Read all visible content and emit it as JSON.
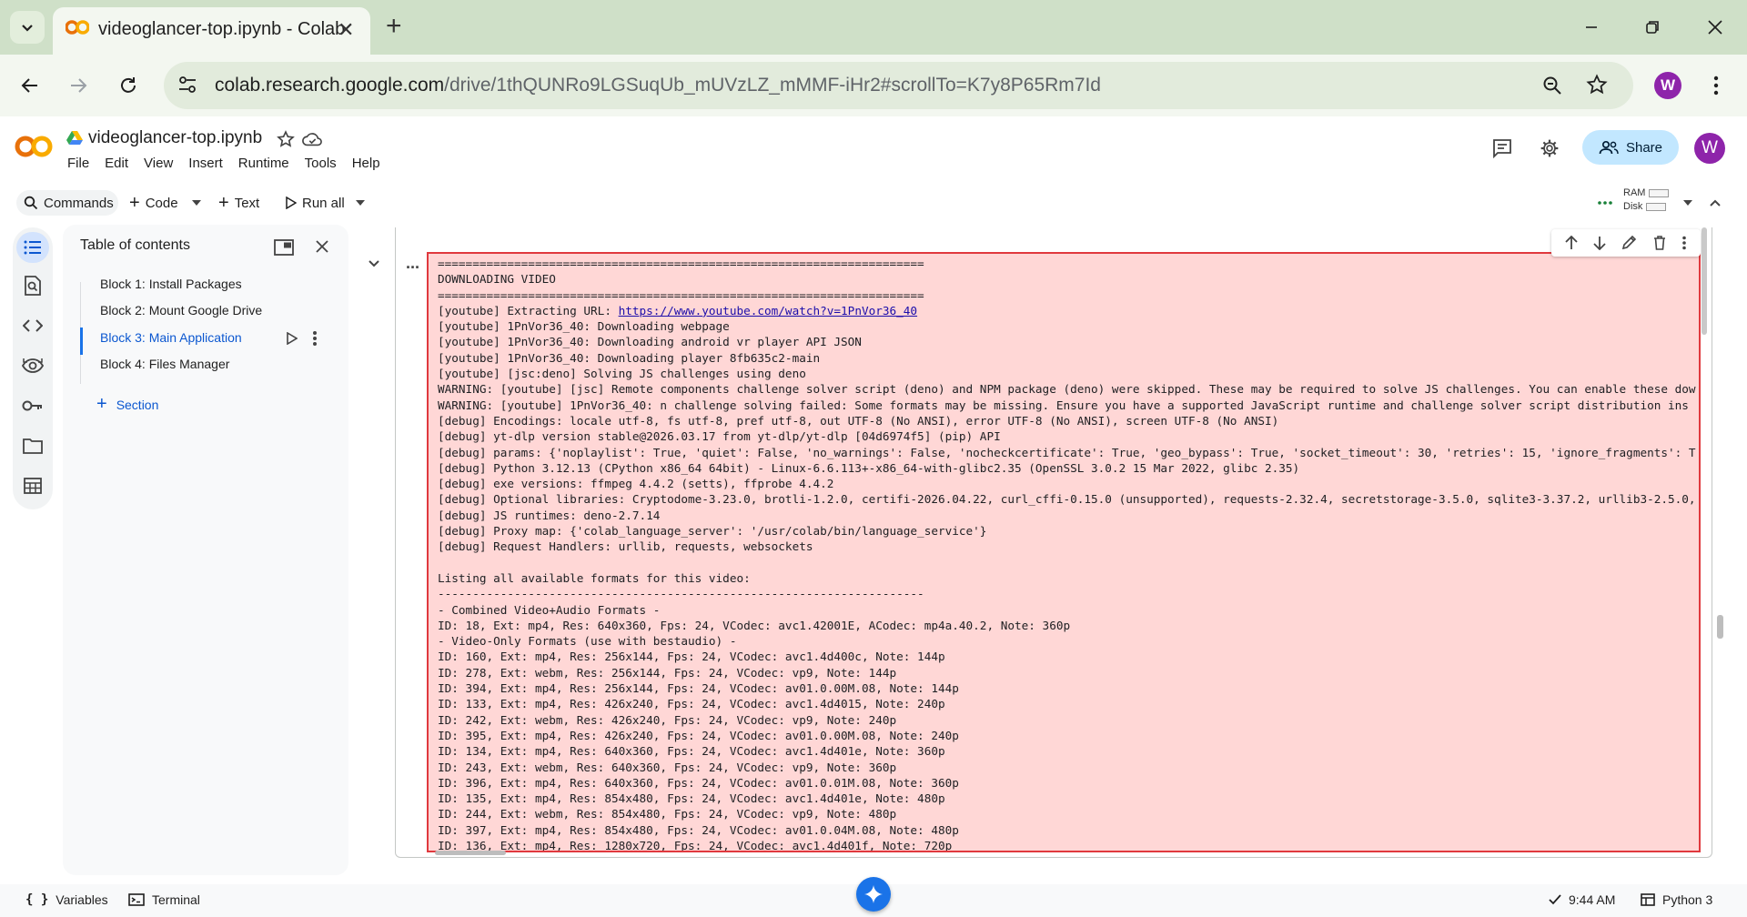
{
  "browser": {
    "tab_title": "videoglancer-top.ipynb - Colab",
    "url_host": "colab.research.google.com",
    "url_path": "/drive/1thQUNRo9LGSuqUb_mUVzLZ_mMMF-iHr2#scrollTo=K7y8P65Rm7Id",
    "profile_initial": "W"
  },
  "colab": {
    "notebook_title": "videoglancer-top.ipynb",
    "menus": [
      "File",
      "Edit",
      "View",
      "Insert",
      "Runtime",
      "Tools",
      "Help"
    ],
    "share_label": "Share",
    "user_initial": "W",
    "toolbar": {
      "commands": "Commands",
      "code": "Code",
      "text": "Text",
      "run_all": "Run all",
      "ram": "RAM",
      "disk": "Disk"
    }
  },
  "toc": {
    "title": "Table of contents",
    "items": [
      "Block 1: Install Packages",
      "Block 2: Mount Google Drive",
      "Block 3: Main Application",
      "Block 4: Files Manager"
    ],
    "active_index": 2,
    "add_section": "Section"
  },
  "output": {
    "url": "https://www.youtube.com/watch?v=1PnVor36_40",
    "lines": [
      "======================================================================",
      "DOWNLOADING VIDEO",
      "======================================================================",
      "[youtube] Extracting URL: ",
      "[youtube] 1PnVor36_40: Downloading webpage",
      "[youtube] 1PnVor36_40: Downloading android vr player API JSON",
      "[youtube] 1PnVor36_40: Downloading player 8fb635c2-main",
      "[youtube] [jsc:deno] Solving JS challenges using deno",
      "WARNING: [youtube] [jsc] Remote components challenge solver script (deno) and NPM package (deno) were skipped. These may be required to solve JS challenges. You can enable these dow",
      "WARNING: [youtube] 1PnVor36_40: n challenge solving failed: Some formats may be missing. Ensure you have a supported JavaScript runtime and challenge solver script distribution ins",
      "[debug] Encodings: locale utf-8, fs utf-8, pref utf-8, out UTF-8 (No ANSI), error UTF-8 (No ANSI), screen UTF-8 (No ANSI)",
      "[debug] yt-dlp version stable@2026.03.17 from yt-dlp/yt-dlp [04d6974f5] (pip) API",
      "[debug] params: {'noplaylist': True, 'quiet': False, 'no_warnings': False, 'nocheckcertificate': True, 'geo_bypass': True, 'socket_timeout': 30, 'retries': 15, 'ignore_fragments': T",
      "[debug] Python 3.12.13 (CPython x86_64 64bit) - Linux-6.6.113+-x86_64-with-glibc2.35 (OpenSSL 3.0.2 15 Mar 2022, glibc 2.35)",
      "[debug] exe versions: ffmpeg 4.4.2 (setts), ffprobe 4.4.2",
      "[debug] Optional libraries: Cryptodome-3.23.0, brotli-1.2.0, certifi-2026.04.22, curl_cffi-0.15.0 (unsupported), requests-2.32.4, secretstorage-3.5.0, sqlite3-3.37.2, urllib3-2.5.0,",
      "[debug] JS runtimes: deno-2.7.14",
      "[debug] Proxy map: {'colab_language_server': '/usr/colab/bin/language_service'}",
      "[debug] Request Handlers: urllib, requests, websockets",
      "",
      "Listing all available formats for this video:",
      "----------------------------------------------------------------------",
      "- Combined Video+Audio Formats -",
      "ID: 18, Ext: mp4, Res: 640x360, Fps: 24, VCodec: avc1.42001E, ACodec: mp4a.40.2, Note: 360p",
      "- Video-Only Formats (use with bestaudio) -",
      "ID: 160, Ext: mp4, Res: 256x144, Fps: 24, VCodec: avc1.4d400c, Note: 144p",
      "ID: 278, Ext: webm, Res: 256x144, Fps: 24, VCodec: vp9, Note: 144p",
      "ID: 394, Ext: mp4, Res: 256x144, Fps: 24, VCodec: av01.0.00M.08, Note: 144p",
      "ID: 133, Ext: mp4, Res: 426x240, Fps: 24, VCodec: avc1.4d4015, Note: 240p",
      "ID: 242, Ext: webm, Res: 426x240, Fps: 24, VCodec: vp9, Note: 240p",
      "ID: 395, Ext: mp4, Res: 426x240, Fps: 24, VCodec: av01.0.00M.08, Note: 240p",
      "ID: 134, Ext: mp4, Res: 640x360, Fps: 24, VCodec: avc1.4d401e, Note: 360p",
      "ID: 243, Ext: webm, Res: 640x360, Fps: 24, VCodec: vp9, Note: 360p",
      "ID: 396, Ext: mp4, Res: 640x360, Fps: 24, VCodec: av01.0.01M.08, Note: 360p",
      "ID: 135, Ext: mp4, Res: 854x480, Fps: 24, VCodec: avc1.4d401e, Note: 480p",
      "ID: 244, Ext: webm, Res: 854x480, Fps: 24, VCodec: vp9, Note: 480p",
      "ID: 397, Ext: mp4, Res: 854x480, Fps: 24, VCodec: av01.0.04M.08, Note: 480p",
      "ID: 136, Ext: mp4, Res: 1280x720, Fps: 24, VCodec: avc1.4d401f, Note: 720p"
    ]
  },
  "statusbar": {
    "variables": "Variables",
    "terminal": "Terminal",
    "time": "9:44 AM",
    "runtime": "Python 3"
  },
  "colors": {
    "accent": "#1a73e8",
    "error_bg": "#ffd7d6",
    "error_border": "#e0393e",
    "tab_bar": "#cfe0c8"
  },
  "icons": [
    "chevron-down-icon",
    "colab-favicon",
    "close-icon",
    "plus-icon",
    "minimize-icon",
    "restore-icon",
    "back-arrow-icon",
    "forward-arrow-icon",
    "reload-icon",
    "site-info-icon",
    "zoom-icon",
    "bookmark-star-icon",
    "more-vert-icon",
    "drive-icon",
    "star-icon",
    "cloud-icon",
    "comment-icon",
    "gear-icon",
    "people-icon",
    "search-icon",
    "play-icon",
    "toc-list-icon",
    "find-icon",
    "code-icon",
    "variables-eye-icon",
    "key-icon",
    "folder-icon",
    "table-icon",
    "popout-icon",
    "arrow-up-icon",
    "arrow-down-icon",
    "edit-icon",
    "trash-icon",
    "gemini-sparkle-icon",
    "checkmark-icon",
    "terminal-icon",
    "braces-icon",
    "python-icon"
  ]
}
